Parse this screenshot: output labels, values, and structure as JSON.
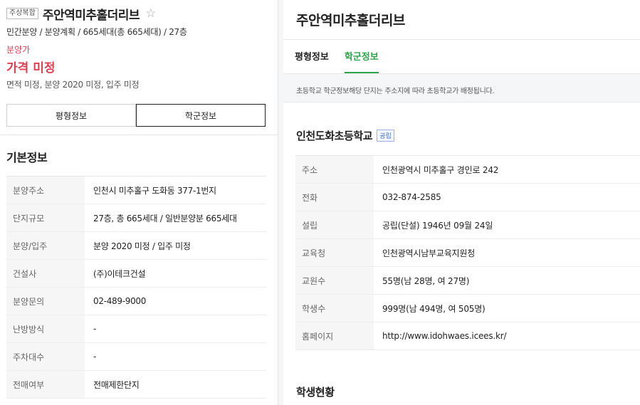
{
  "listing": {
    "badge": "주상복합",
    "title": "주안역미추홀더리브",
    "star": "☆",
    "subtitle": "민간분양 / 분양계획 / 665세대(총 665세대) / 27층",
    "price_label": "분양가",
    "price": "가격 미정",
    "meta": "면적 미정, 분양 2020 미정, 입주 미정"
  },
  "buttons": {
    "floor_plan": "평형정보",
    "school": "학군정보"
  },
  "basic": {
    "title": "기본정보",
    "rows": [
      {
        "k": "분양주소",
        "v": "인천시 미추홀구 도화동 377-1번지"
      },
      {
        "k": "단지규모",
        "v": "27층, 총 665세대 / 일반분양분 665세대"
      },
      {
        "k": "분양/입주",
        "v": "분양 2020 미정 / 입주 미정"
      },
      {
        "k": "건설사",
        "v": "(주)이테크건설"
      },
      {
        "k": "분양문의",
        "v": "02-489-9000"
      },
      {
        "k": "난방방식",
        "v": "-"
      },
      {
        "k": "주차대수",
        "v": "-"
      },
      {
        "k": "전매여부",
        "v": "전매제한단지"
      }
    ]
  },
  "right": {
    "title": "주안역미추홀더리브",
    "tabs": [
      "평형정보",
      "학군정보"
    ],
    "notice": "초등학교 학군정보해당 단지는 주소지에 따라 초등학교가 배정됩니다.",
    "school_name": "인천도화초등학교",
    "school_badge": "공립",
    "rows": [
      {
        "k": "주소",
        "v": "인천광역시 미추홀구 경인로 242"
      },
      {
        "k": "전화",
        "v": "032-874-2585"
      },
      {
        "k": "설립",
        "v": "공립(단설) 1946년 09월 24일"
      },
      {
        "k": "교육청",
        "v": "인천광역시남부교육지원청"
      },
      {
        "k": "교원수",
        "v": "55명(남 28명, 여 27명)"
      },
      {
        "k": "학생수",
        "v": "999명(남 494명, 여 505명)"
      },
      {
        "k": "홈페이지",
        "v": "http://www.idohwaes.icees.kr/"
      }
    ],
    "section2": "학생현황"
  }
}
